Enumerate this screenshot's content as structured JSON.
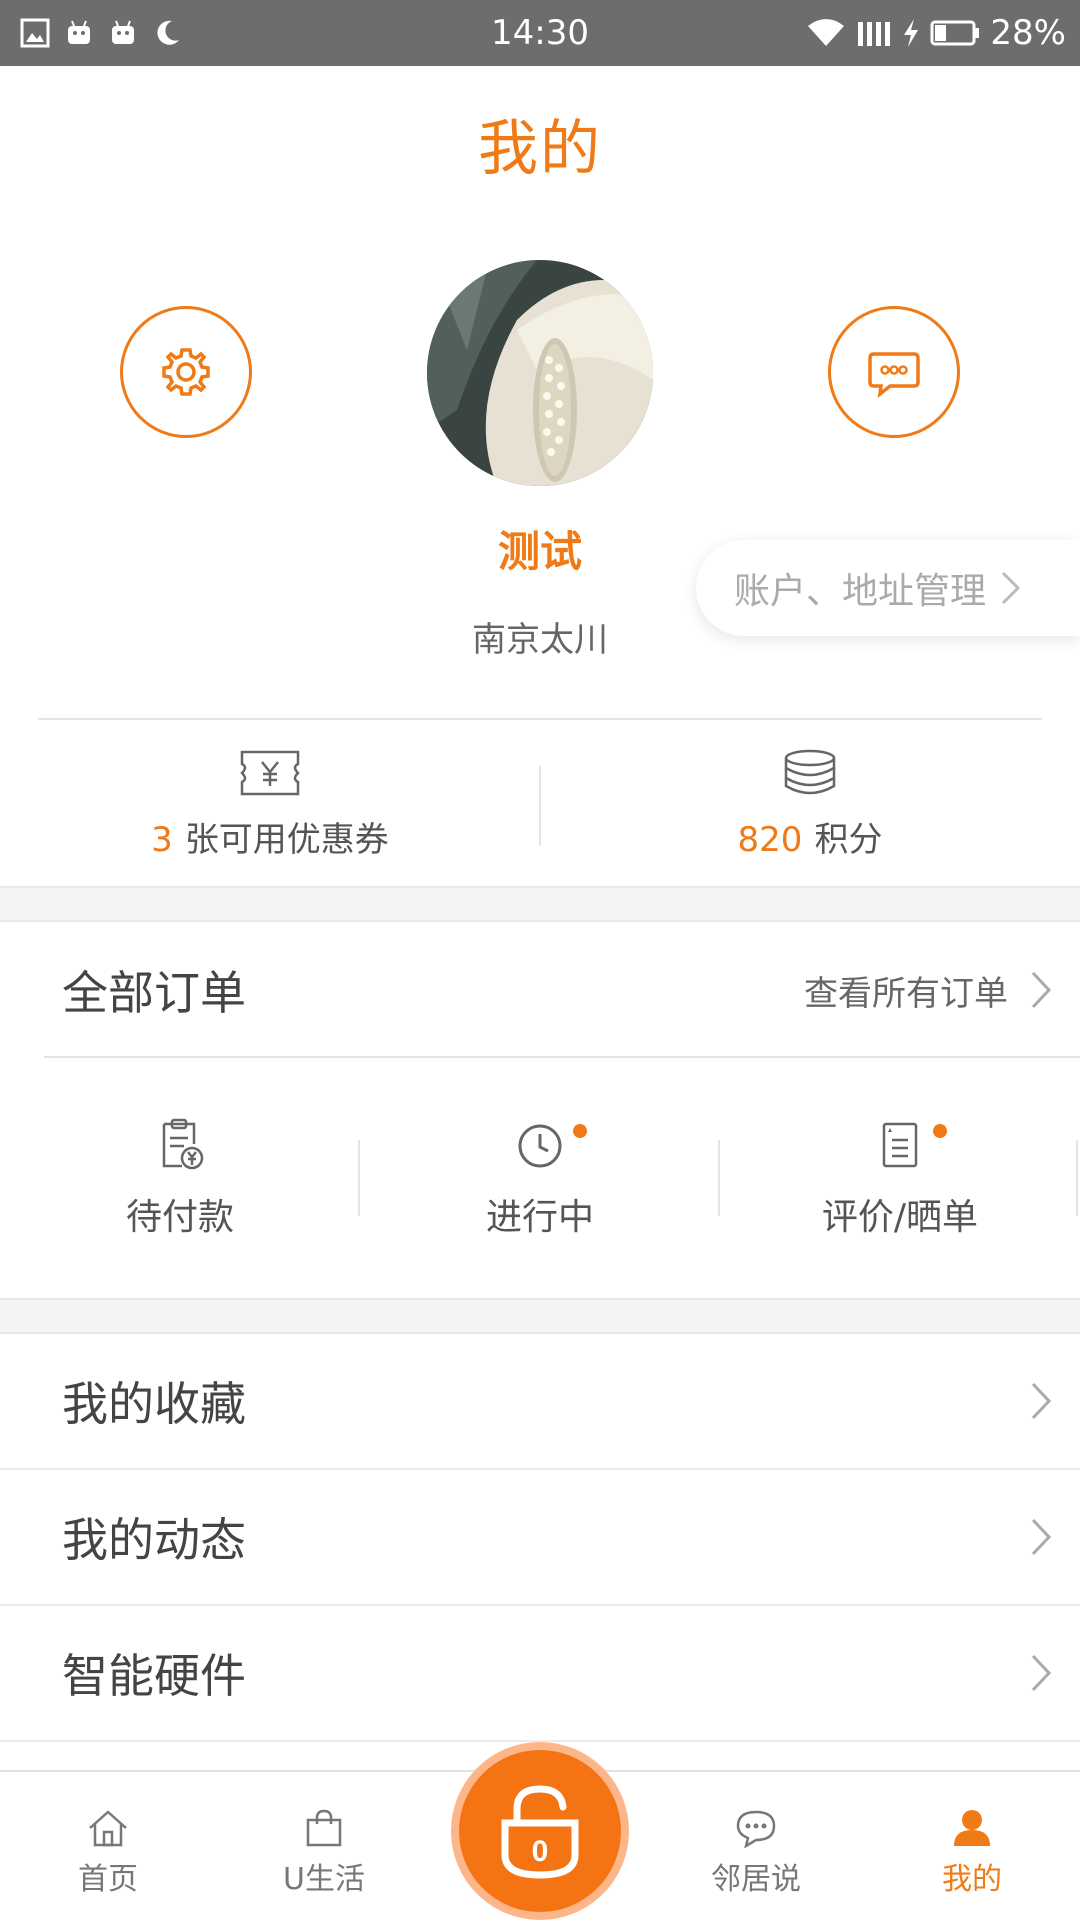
{
  "status_bar": {
    "time": "14:30",
    "battery": "28%"
  },
  "page_title": "我的",
  "profile": {
    "name": "测试",
    "community": "南京太川",
    "account_link": "账户、地址管理"
  },
  "stats": {
    "coupons_count": "3",
    "coupons_label": "张可用优惠券",
    "points_count": "820",
    "points_label": "积分"
  },
  "orders": {
    "title": "全部订单",
    "view_all": "查看所有订单",
    "statuses": [
      {
        "label": "待付款"
      },
      {
        "label": "进行中"
      },
      {
        "label": "评价/晒单"
      }
    ]
  },
  "menu": [
    {
      "label": "我的收藏"
    },
    {
      "label": "我的动态"
    },
    {
      "label": "智能硬件"
    }
  ],
  "tabs": [
    {
      "label": "首页"
    },
    {
      "label": "U生活"
    },
    {
      "label": "邻居说"
    },
    {
      "label": "我的"
    }
  ],
  "unlock_button_text": "0",
  "colors": {
    "accent": "#f07a16",
    "status_bar": "#6d6d6d"
  }
}
